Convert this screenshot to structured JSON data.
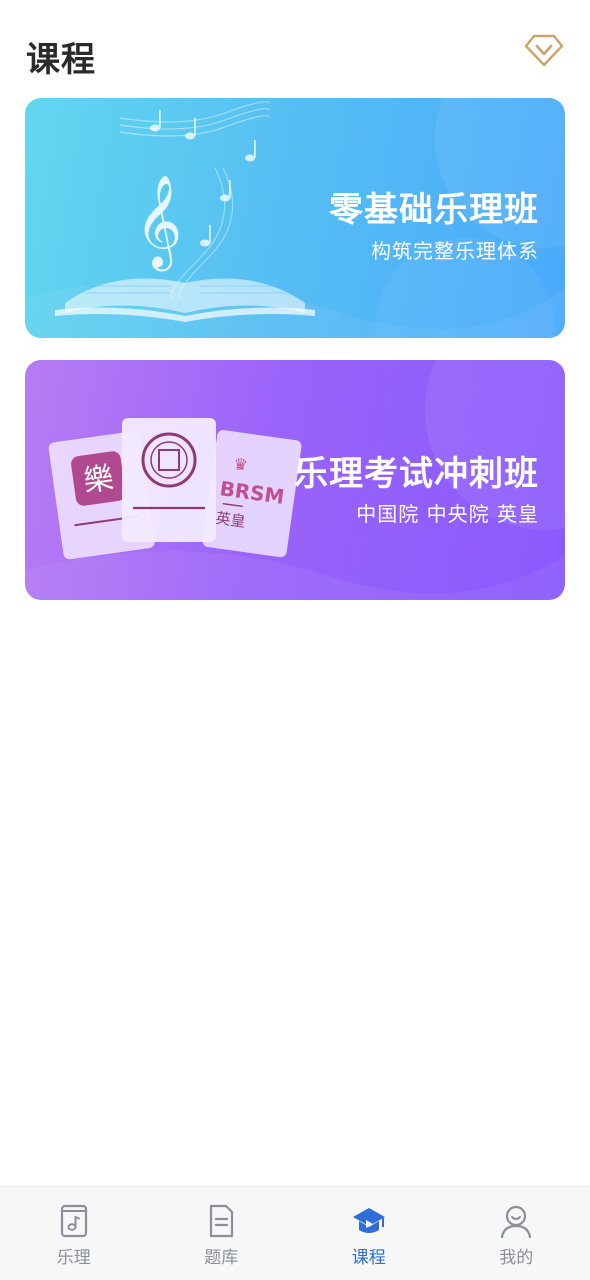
{
  "header": {
    "title": "课程"
  },
  "courses": [
    {
      "title": "零基础乐理班",
      "subtitle": "构筑完整乐理体系"
    },
    {
      "title": "乐理考试冲刺班",
      "subtitle": "中国院 中央院 英皇",
      "badges": [
        "BRSM",
        "英皇"
      ]
    }
  ],
  "tabbar": {
    "items": [
      {
        "label": "乐理",
        "icon": "music-book-icon"
      },
      {
        "label": "题库",
        "icon": "document-icon"
      },
      {
        "label": "课程",
        "icon": "graduation-cap-icon",
        "active": true
      },
      {
        "label": "我的",
        "icon": "user-icon"
      }
    ]
  },
  "colors": {
    "active_tab": "#2f6cd8",
    "inactive_tab": "#8a8f99",
    "vip_gold": "#c9a46a"
  }
}
